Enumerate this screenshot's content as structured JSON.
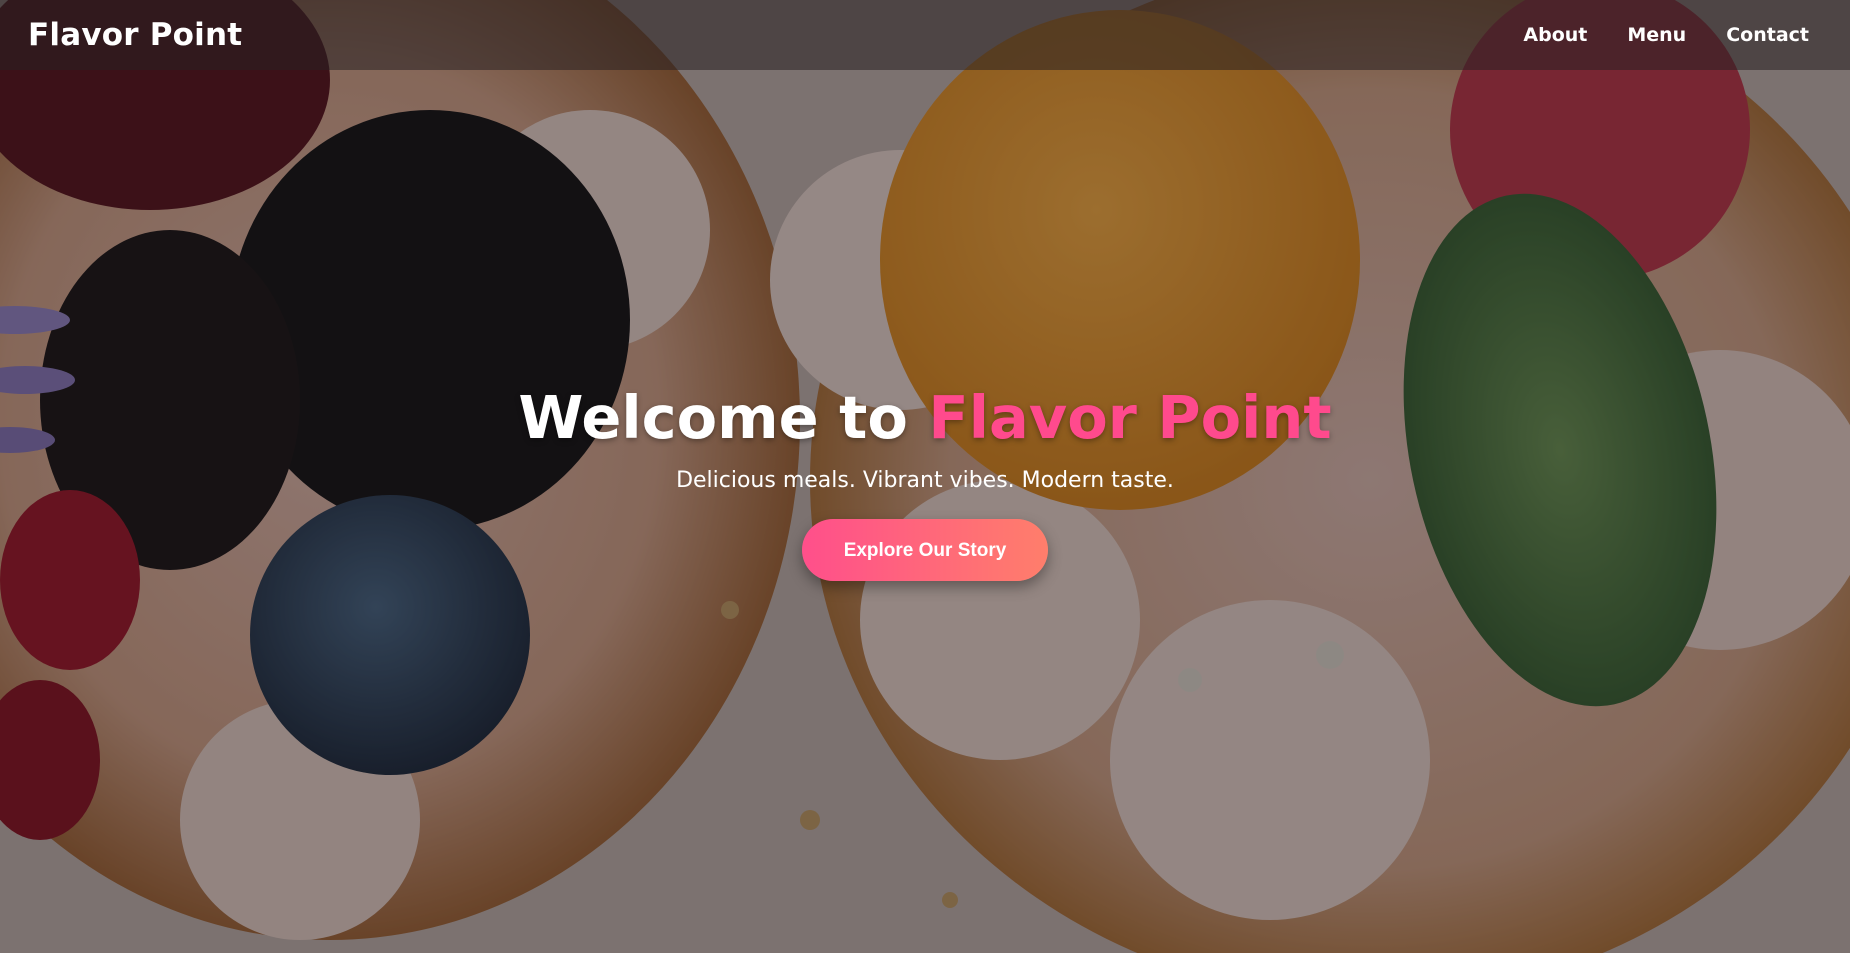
{
  "nav": {
    "brand": "Flavor Point",
    "links": [
      "About",
      "Menu",
      "Contact"
    ]
  },
  "hero": {
    "title_prefix": "Welcome to ",
    "title_accent": "Flavor Point",
    "subtitle": "Delicious meals. Vibrant vibes. Modern taste.",
    "cta_label": "Explore Our Story"
  },
  "colors": {
    "accent": "#ff4a8d",
    "button_gradient_start": "#ff4f8b",
    "button_gradient_end": "#ff7e6b",
    "text": "#ffffff"
  }
}
